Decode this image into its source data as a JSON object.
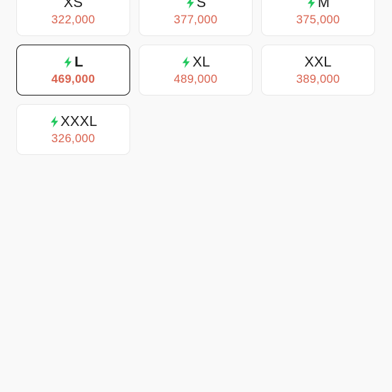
{
  "accent_price_color": "#d9624f",
  "bolt_color": "#21c75d",
  "options": [
    {
      "size": "XS",
      "price": "322,000",
      "fast_delivery": false,
      "selected": false
    },
    {
      "size": "S",
      "price": "377,000",
      "fast_delivery": true,
      "selected": false
    },
    {
      "size": "M",
      "price": "375,000",
      "fast_delivery": true,
      "selected": false
    },
    {
      "size": "L",
      "price": "469,000",
      "fast_delivery": true,
      "selected": true
    },
    {
      "size": "XL",
      "price": "489,000",
      "fast_delivery": true,
      "selected": false
    },
    {
      "size": "XXL",
      "price": "389,000",
      "fast_delivery": false,
      "selected": false
    },
    {
      "size": "XXXL",
      "price": "326,000",
      "fast_delivery": true,
      "selected": false
    }
  ]
}
